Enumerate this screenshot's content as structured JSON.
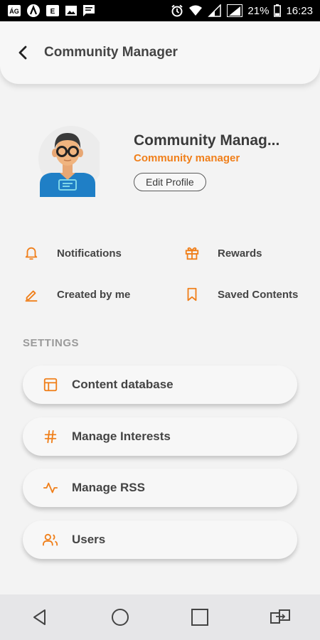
{
  "status_bar": {
    "battery_percent": "21%",
    "time": "16:23"
  },
  "header": {
    "title": "Community Manager"
  },
  "profile": {
    "name": "Community Manag...",
    "role": "Community manager",
    "edit_label": "Edit Profile"
  },
  "quick_links": {
    "notifications": "Notifications",
    "rewards": "Rewards",
    "created_by_me": "Created by me",
    "saved_contents": "Saved Contents"
  },
  "settings": {
    "heading": "SETTINGS",
    "items": [
      {
        "label": "Content database",
        "icon": "layout-icon"
      },
      {
        "label": "Manage Interests",
        "icon": "hashtag-icon"
      },
      {
        "label": "Manage RSS",
        "icon": "activity-icon"
      },
      {
        "label": "Users",
        "icon": "users-icon"
      }
    ]
  },
  "colors": {
    "accent": "#f07f1a",
    "background": "#f3f3f3",
    "card": "#f7f7f7"
  }
}
